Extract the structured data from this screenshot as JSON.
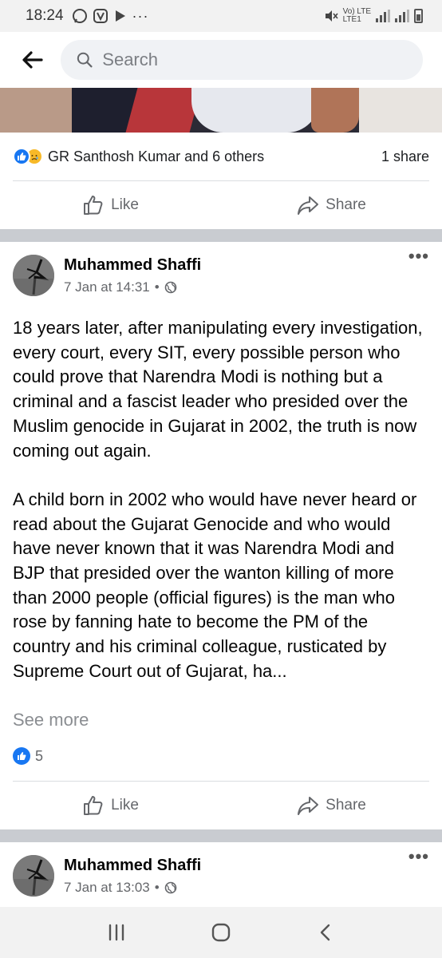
{
  "status_bar": {
    "time": "18:24",
    "network_label_top": "Vo) LTE",
    "network_label_bottom": "LTE1"
  },
  "header": {
    "back_icon": "arrow-left-icon",
    "search_placeholder": "Search"
  },
  "post1_footer": {
    "reactions_text": "GR Santhosh Kumar and 6 others",
    "shares_text": "1 share",
    "like_label": "Like",
    "share_label": "Share"
  },
  "post2": {
    "author": "Muhammed Shaffi",
    "timestamp": "7 Jan at 14:31",
    "separator": "•",
    "paragraphs": [
      "18 years later, after manipulating every investigation, every court, every SIT, every possible person who could prove that Narendra Modi is nothing but a criminal and a fascist leader who presided over the Muslim genocide in Gujarat in 2002, the truth is now coming out again.",
      "A child born in 2002 who would have never heard or read about the Gujarat Genocide and who would have never known that it was Narendra Modi and BJP that presided over the wanton killing of more than 2000 people (official figures) is the man who rose by fanning hate to become the PM of the country and his criminal colleague, rusticated by Supreme Court out of Gujarat, ha..."
    ],
    "see_more": "See more",
    "like_count": "5",
    "like_label": "Like",
    "share_label": "Share"
  },
  "post3": {
    "author": "Muhammed Shaffi",
    "timestamp": "7 Jan at 13:03",
    "separator": "•"
  },
  "colors": {
    "facebook_blue": "#1877f2",
    "secondary_text": "#65676b",
    "feed_separator": "#c9ccd1"
  }
}
